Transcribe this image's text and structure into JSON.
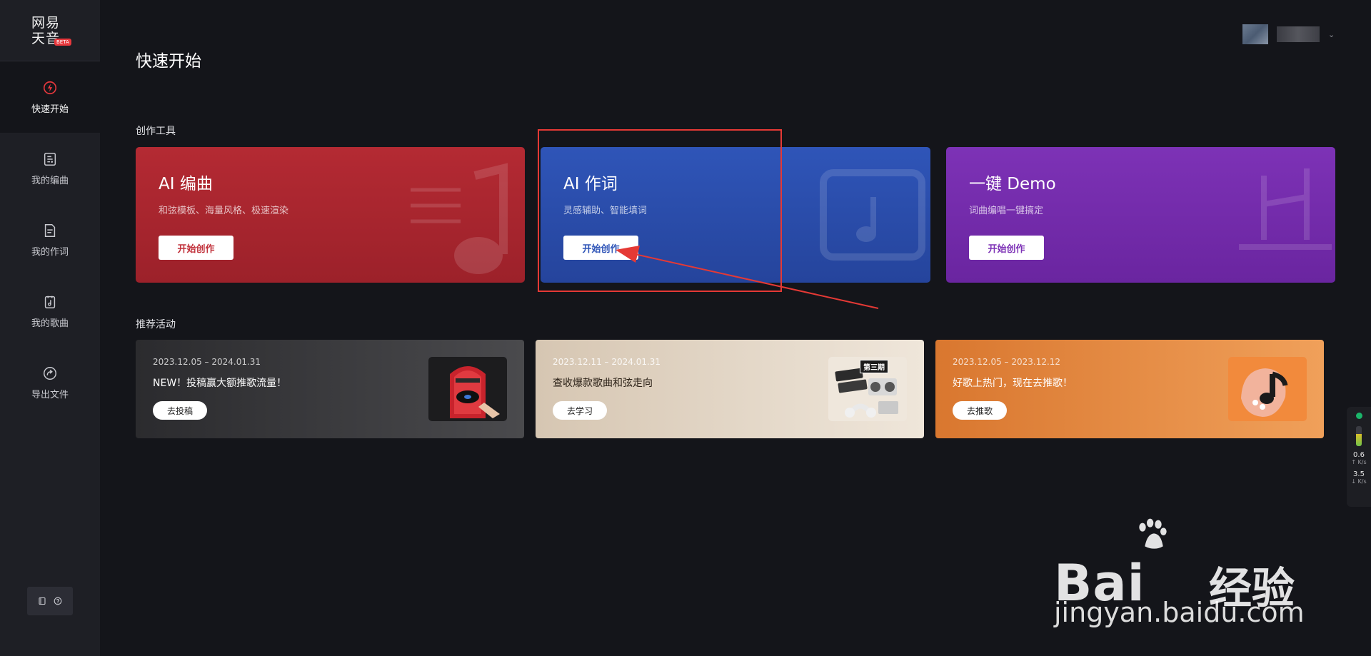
{
  "sidebar": {
    "logo_line1": "网易",
    "logo_line2": "天音",
    "logo_badge": "BETA",
    "items": [
      {
        "label": "快速开始",
        "icon": "lightning-icon",
        "active": true
      },
      {
        "label": "我的编曲",
        "icon": "arrangement-icon",
        "active": false
      },
      {
        "label": "我的作词",
        "icon": "lyrics-doc-icon",
        "active": false
      },
      {
        "label": "我的歌曲",
        "icon": "song-file-icon",
        "active": false
      },
      {
        "label": "导出文件",
        "icon": "export-icon",
        "active": false
      }
    ],
    "bottom_icons": [
      "book-icon",
      "help-icon"
    ]
  },
  "header": {
    "title": "快速开始",
    "user_caret": "⌄"
  },
  "tools": {
    "section_label": "创作工具",
    "cards": [
      {
        "title": "AI 编曲",
        "desc": "和弦模板、海量风格、极速渲染",
        "button": "开始创作",
        "color": "#b42a33"
      },
      {
        "title": "AI 作词",
        "desc": "灵感辅助、智能填词",
        "button": "开始创作",
        "color": "#2f55b8"
      },
      {
        "title": "一键 Demo",
        "desc": "词曲编唱一键搞定",
        "button": "开始创作",
        "color": "#7d32b6"
      }
    ]
  },
  "activities": {
    "section_label": "推荐活动",
    "cards": [
      {
        "date": "2023.12.05 – 2024.01.31",
        "title": "NEW！投稿赢大额推歌流量！",
        "button": "去投稿"
      },
      {
        "date": "2023.12.11 – 2024.01.31",
        "title": "查收爆款歌曲和弦走向",
        "button": "去学习",
        "thumb_tag": "第三期"
      },
      {
        "date": "2023.12.05 – 2023.12.12",
        "title": "好歌上热门，现在去推歌！",
        "button": "去推歌"
      }
    ]
  },
  "net_widget": {
    "up_value": "0.6",
    "up_unit": "↑ K/s",
    "down_value": "3.5",
    "down_unit": "↓ K/s"
  },
  "watermark": {
    "brand": "Bai",
    "brand_cn": "经验",
    "url": "jingyan.baidu.com"
  },
  "colors": {
    "annotation": "#e53935",
    "background": "#14151a",
    "sidebar": "#1e1f25"
  }
}
